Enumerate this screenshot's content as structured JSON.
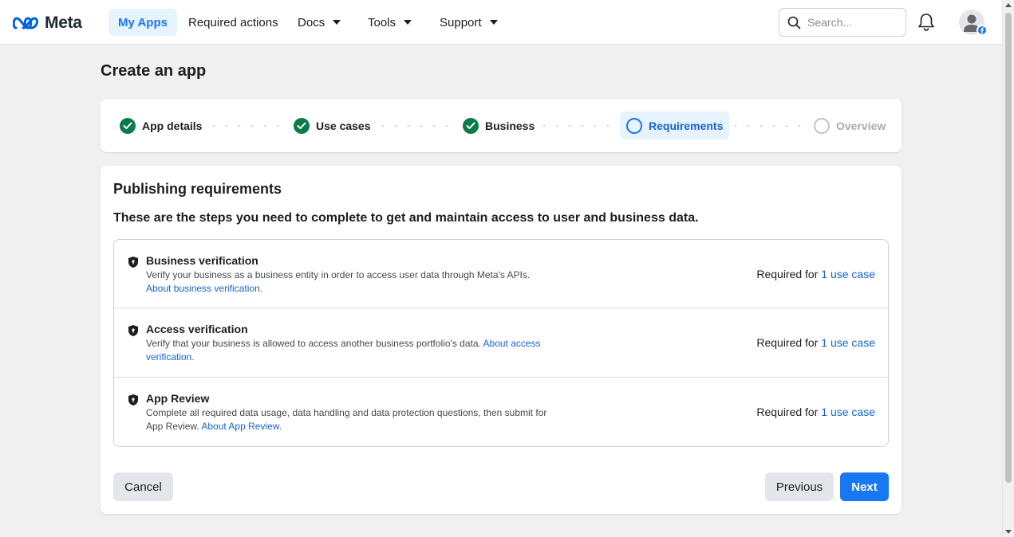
{
  "nav": {
    "brand": "Meta",
    "items": [
      {
        "label": "My Apps"
      },
      {
        "label": "Required actions"
      },
      {
        "label": "Docs"
      },
      {
        "label": "Tools"
      },
      {
        "label": "Support"
      }
    ],
    "search_placeholder": "Search..."
  },
  "page": {
    "title": "Create an app"
  },
  "stepper": {
    "steps": [
      {
        "label": "App details",
        "status": "done"
      },
      {
        "label": "Use cases",
        "status": "done"
      },
      {
        "label": "Business",
        "status": "done"
      },
      {
        "label": "Requirements",
        "status": "current"
      },
      {
        "label": "Overview",
        "status": "future"
      }
    ]
  },
  "publishing": {
    "title": "Publishing requirements",
    "subtitle": "These are the steps you need to complete to get and maintain access to user and business data.",
    "items": [
      {
        "title": "Business verification",
        "description": "Verify your business as a business entity in order to access user data through Meta's APIs.",
        "link": "About business verification.",
        "required_prefix": "Required for",
        "required_link": "1 use case"
      },
      {
        "title": "Access verification",
        "description": "Verify that your business is allowed to access another business portfolio's data.",
        "link": "About access verification.",
        "required_prefix": "Required for",
        "required_link": "1 use case"
      },
      {
        "title": "App Review",
        "description": "Complete all required data usage, data handling and data protection questions, then submit for App Review.",
        "link": "About App Review.",
        "required_prefix": "Required for",
        "required_link": "1 use case"
      }
    ]
  },
  "actions": {
    "cancel": "Cancel",
    "previous": "Previous",
    "next": "Next"
  },
  "colors": {
    "accent": "#1877f2",
    "done": "#0a7c4a",
    "link": "#1763cf"
  }
}
